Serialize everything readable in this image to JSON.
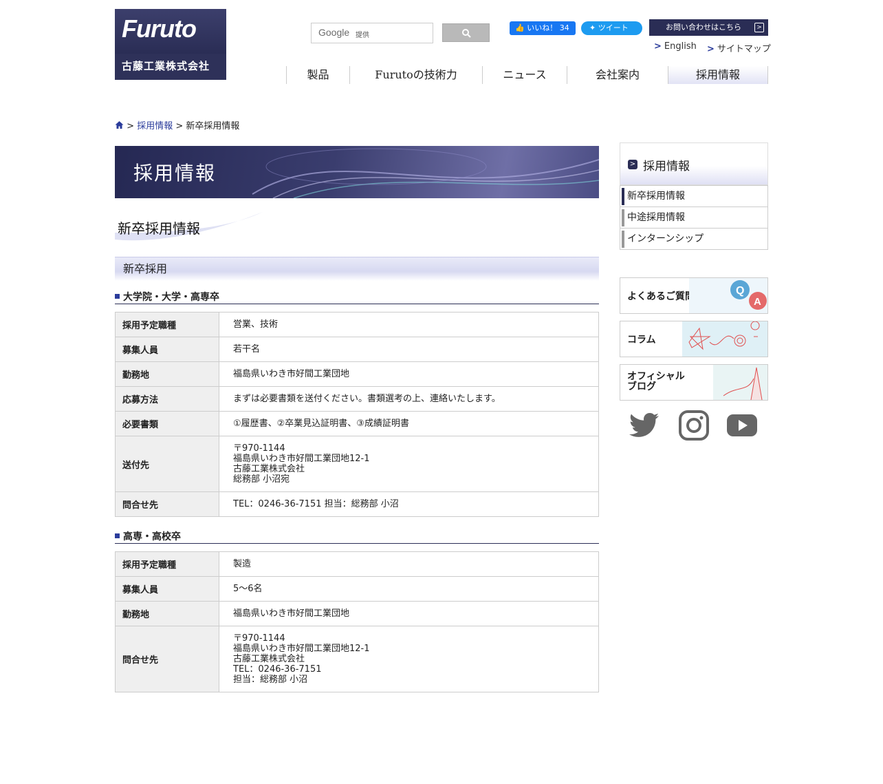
{
  "header": {
    "logo_word": "Furuto",
    "logo_company": "古藤工業株式会社",
    "search": {
      "brand": "Google",
      "provided": "提供"
    },
    "facebook_like": "いいね！ 34",
    "tweet": "ツイート",
    "contact_button": "お問い合わせはこちら",
    "links": [
      ">",
      "English",
      ">",
      "サイトマップ"
    ]
  },
  "nav": [
    "製品",
    "Furutoの技術力",
    "ニュース",
    "会社案内",
    "採用情報"
  ],
  "breadcrumb": {
    "sep1": ">",
    "parent": "採用情報",
    "sep2": ">",
    "current": "新卒採用情報"
  },
  "banner_title": "採用情報",
  "page_heading": "新卒採用情報",
  "section_title": "新卒採用",
  "univ": {
    "title": "大学院・大学・高専卒",
    "rows": [
      {
        "k": "採用予定職種",
        "v": [
          "営業、技術"
        ]
      },
      {
        "k": "募集人員",
        "v": [
          "若干名"
        ]
      },
      {
        "k": "勤務地",
        "v": [
          "福島県いわき市好間工業団地"
        ]
      },
      {
        "k": "応募方法",
        "v": [
          "まずは必要書類を送付ください。書類選考の上、連絡いたします。"
        ]
      },
      {
        "k": "必要書類",
        "v": [
          "①履歴書、②卒業見込証明書、③成績証明書"
        ]
      },
      {
        "k": "送付先",
        "v": [
          "〒970-1144",
          "福島県いわき市好間工業団地12-1",
          "古藤工業株式会社",
          "総務部 小沼宛"
        ]
      },
      {
        "k": "問合せ先",
        "v": [
          "TEL：0246-36-7151 担当：総務部 小沼"
        ]
      }
    ]
  },
  "highschool": {
    "title": "高専・高校卒",
    "rows": [
      {
        "k": "採用予定職種",
        "v": [
          "製造"
        ]
      },
      {
        "k": "募集人員",
        "v": [
          "5～6名"
        ]
      },
      {
        "k": "勤務地",
        "v": [
          "福島県いわき市好間工業団地"
        ]
      },
      {
        "k": "問合せ先",
        "v": [
          "〒970-1144",
          "福島県いわき市好間工業団地12-1",
          "古藤工業株式会社",
          "TEL：0246-36-7151",
          "担当：総務部 小沼"
        ]
      }
    ]
  },
  "sidebar": {
    "title": "採用情報",
    "items": [
      "新卒採用情報",
      "中途採用情報",
      "インターンシップ"
    ],
    "cards": [
      "よくあるご質問",
      "コラム",
      "オフィシャル\nブログ"
    ],
    "social": [
      "twitter-icon",
      "instagram-icon",
      "youtube-icon"
    ]
  },
  "colors": {
    "navy": "#2a2d55",
    "link": "#2b3c9b",
    "row_key_bg": "#efefef"
  }
}
